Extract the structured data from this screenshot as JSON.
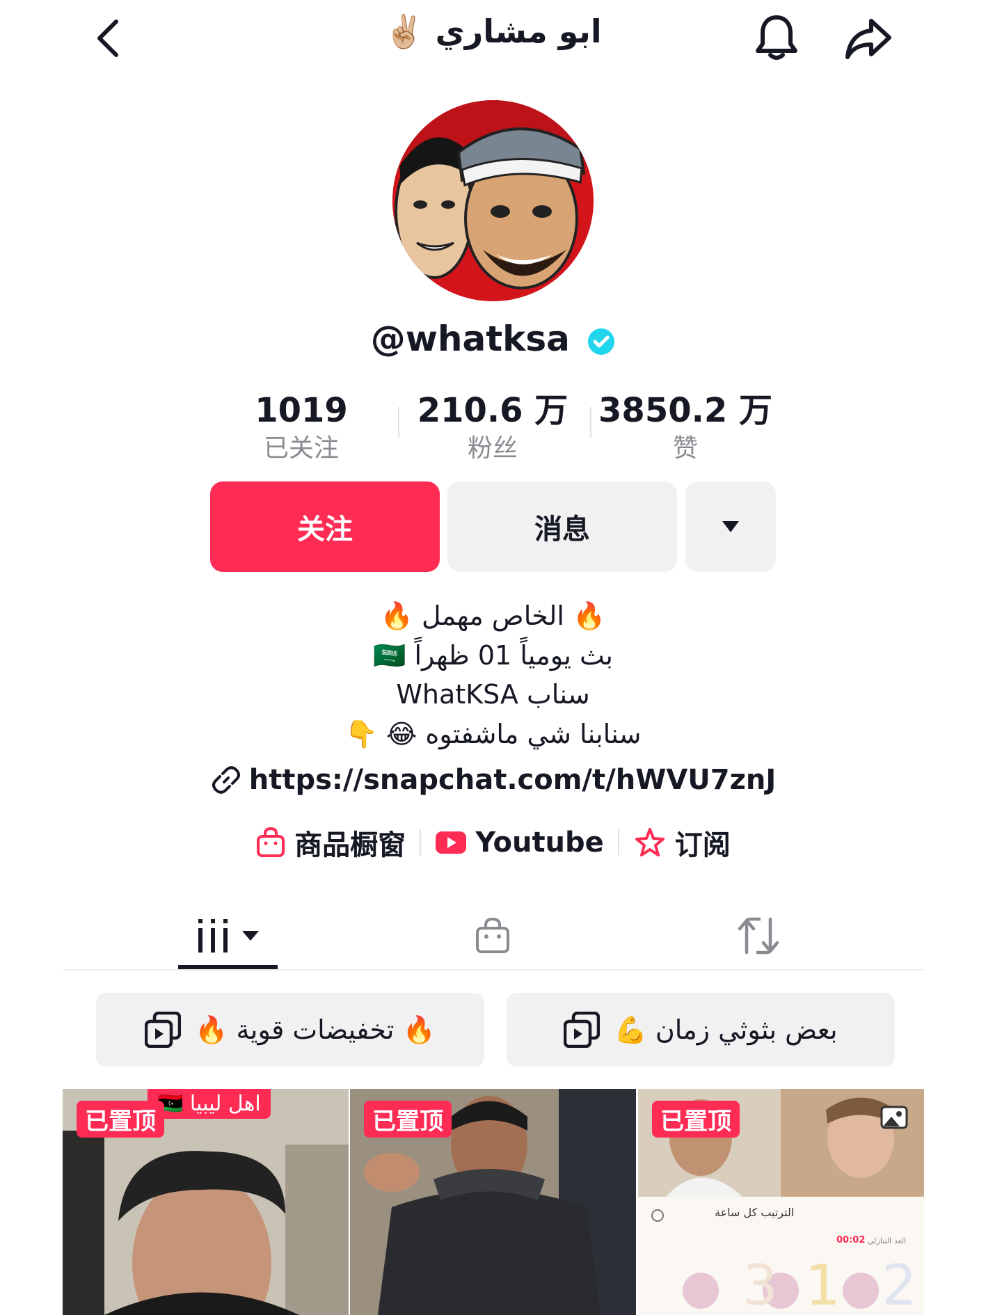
{
  "header": {
    "title": "ابو مشاري ✌🏼"
  },
  "profile": {
    "username": "@whatksa"
  },
  "stats": [
    {
      "value": "1019",
      "label": "已关注"
    },
    {
      "value": "210.6 万",
      "label": "粉丝"
    },
    {
      "value": "3850.2 万",
      "label": "赞"
    }
  ],
  "actions": {
    "follow": "关注",
    "message": "消息"
  },
  "bio": {
    "lines": [
      "🔥 الخاص مهمل   🔥",
      "بث يومياً 01 ظهراً 🇸🇦",
      "سناب WhatKSA",
      "سنابنا شي ماشفتوه 😂 👇"
    ],
    "link": "https://snapchat.com/t/hWVU7znJ"
  },
  "chips": [
    "商品橱窗",
    "Youtube",
    "订阅"
  ],
  "playlists": [
    "🔥 تخفيضات قوية 🔥",
    "بعض بثوثي زمان 💪"
  ],
  "videos": [
    {
      "badge": "已置顶",
      "caption": "اهل ليبيا 🇱🇾"
    },
    {
      "badge": "已置顶"
    },
    {
      "badge": "已置顶",
      "overlay_title": "الترتيب كل ساعة",
      "overlay_time": "00:02",
      "overlay_label": "العد التنازلي"
    }
  ],
  "colors": {
    "accent": "#fe2c55",
    "verified": "#20d5ec"
  }
}
